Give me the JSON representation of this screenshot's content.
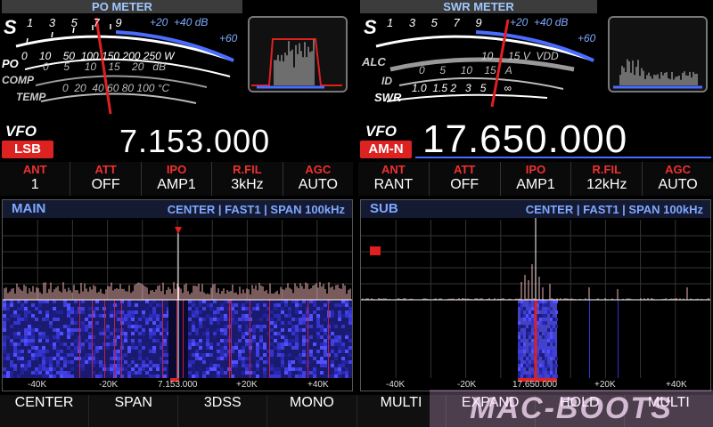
{
  "left": {
    "meter_title": "PO METER",
    "meter": {
      "s_label": "S",
      "s_scale": [
        "1",
        "3",
        "5",
        "7",
        "9",
        "+20",
        "+40",
        "dB",
        "+60"
      ],
      "po_label": "PO",
      "po_scale": [
        "0",
        "10",
        "50",
        "100",
        "150",
        "200",
        "250",
        "W"
      ],
      "comp_label": "COMP",
      "comp_scale": [
        "0",
        "5",
        "10",
        "15",
        "20",
        "dB"
      ],
      "temp_label": "TEMP",
      "temp_scale": [
        "0",
        "20",
        "40",
        "60",
        "80",
        "100",
        "°C"
      ]
    },
    "vfo_label": "VFO",
    "mode": "LSB",
    "frequency": "7.153.000",
    "functions": [
      {
        "label": "ANT",
        "value": "1"
      },
      {
        "label": "ATT",
        "value": "OFF"
      },
      {
        "label": "IPO",
        "value": "AMP1"
      },
      {
        "label": "R.FIL",
        "value": "3kHz"
      },
      {
        "label": "AGC",
        "value": "AUTO"
      }
    ],
    "scope": {
      "name": "MAIN",
      "info": "CENTER | FAST1 | SPAN   100kHz",
      "axis": [
        "-40K",
        "-20K",
        "7.153.000",
        "+20K",
        "+40K"
      ]
    }
  },
  "right": {
    "meter_title": "SWR METER",
    "meter": {
      "s_label": "S",
      "s_scale": [
        "1",
        "3",
        "5",
        "7",
        "9",
        "+20",
        "+40",
        "dB",
        "+60"
      ],
      "alc_label": "ALC",
      "vdd_scale": [
        "0",
        "5",
        "10",
        "15V",
        "VDD"
      ],
      "id_label": "ID",
      "id_scale": [
        "0",
        "5",
        "10",
        "15",
        "A"
      ],
      "swr_label": "SWR",
      "swr_scale": [
        "1.0",
        "1.5",
        "2",
        "3",
        "5",
        "∞"
      ]
    },
    "vfo_label": "VFO",
    "mode": "AM-N",
    "frequency": "17.650.000",
    "functions": [
      {
        "label": "ANT",
        "value": "RANT"
      },
      {
        "label": "ATT",
        "value": "OFF"
      },
      {
        "label": "IPO",
        "value": "AMP1"
      },
      {
        "label": "R.FIL",
        "value": "12kHz"
      },
      {
        "label": "AGC",
        "value": "AUTO"
      }
    ],
    "scope": {
      "name": "SUB",
      "info": "CENTER | FAST1 | SPAN   100kHz",
      "axis": [
        "-40K",
        "-20K",
        "17.650.000",
        "+20K",
        "+40K"
      ]
    }
  },
  "softkeys": [
    "CENTER",
    "SPAN",
    "3DSS",
    "MONO",
    "MULTI",
    "EXPAND",
    "HOLD",
    "MULTI"
  ],
  "watermark": "MAC-BOOTS",
  "colors": {
    "accent": "#7fa8ff",
    "alert": "#e02020",
    "mode_badge": "#d22222",
    "needle": "#e02020",
    "scale_blue": "#4a6cff"
  }
}
